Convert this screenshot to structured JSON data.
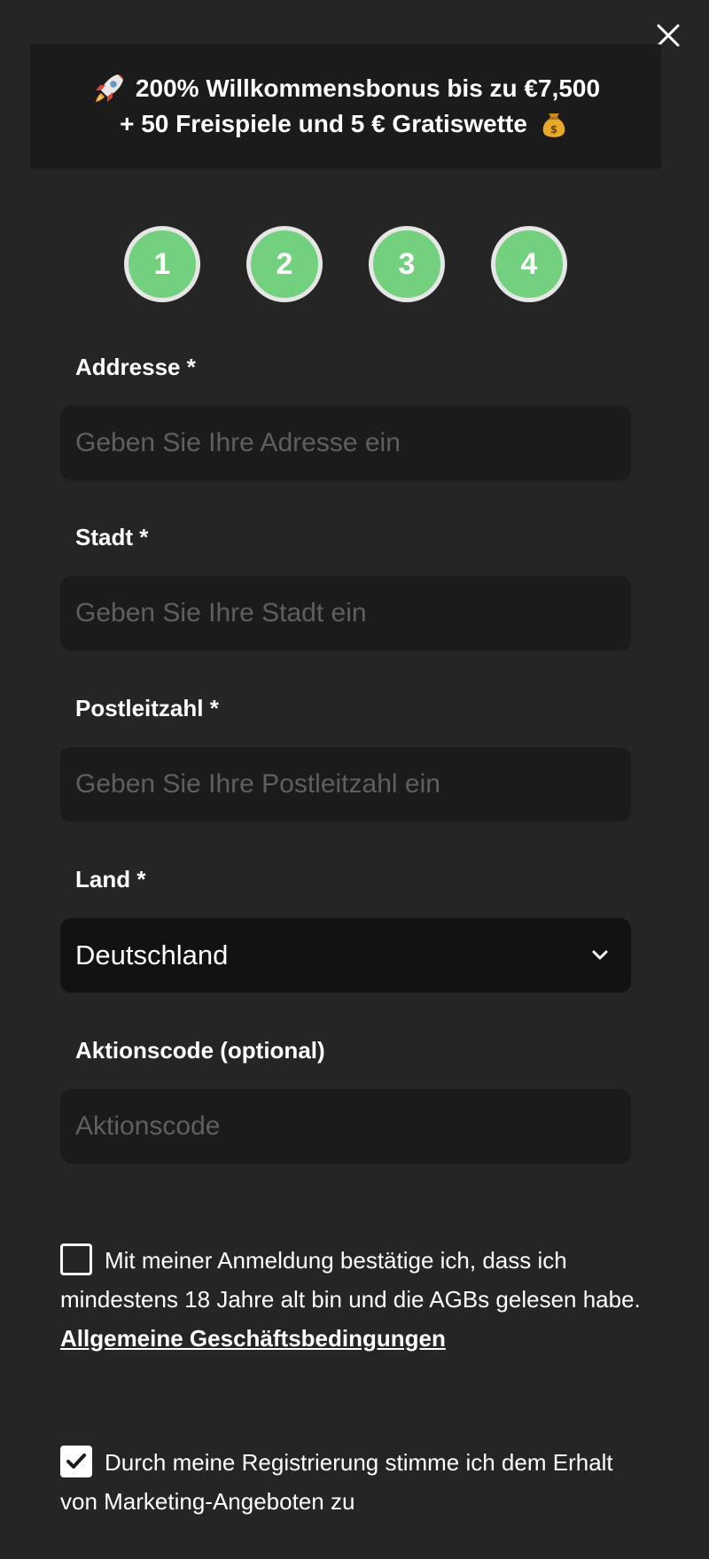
{
  "close": {
    "icon": "close-icon"
  },
  "banner": {
    "line1_icon": "rocket-emoji",
    "line1": "200% Willkommensbonus bis zu €7,500",
    "line2": "+ 50 Freispiele und 5 € Gratiswette",
    "line2_icon": "money-bag-emoji"
  },
  "steps": [
    "1",
    "2",
    "3",
    "4"
  ],
  "form": {
    "address": {
      "label": "Addresse *",
      "placeholder": "Geben Sie Ihre Adresse ein",
      "value": ""
    },
    "city": {
      "label": "Stadt *",
      "placeholder": "Geben Sie Ihre Stadt ein",
      "value": ""
    },
    "postal": {
      "label": "Postleitzahl *",
      "placeholder": "Geben Sie Ihre Postleitzahl ein",
      "value": ""
    },
    "country": {
      "label": "Land *",
      "selected": "Deutschland",
      "icon": "chevron-down-icon"
    },
    "promo": {
      "label": "Aktionscode (optional)",
      "placeholder": "Aktionscode",
      "value": ""
    }
  },
  "terms": {
    "checked": false,
    "text": "Mit meiner Anmeldung bestätige ich, dass ich mindestens 18 Jahre alt bin und die AGBs gelesen habe.",
    "link": "Allgemeine Geschäftsbedingungen"
  },
  "marketing": {
    "checked": true,
    "text": "Durch meine Registrierung stimme ich dem Erhalt von Marketing-Angeboten zu"
  },
  "colors": {
    "background": "#252525",
    "panel": "#1b1b1c",
    "step_fill": "#72d07e",
    "step_border": "#e6e6e6",
    "placeholder": "#5f5f62"
  }
}
